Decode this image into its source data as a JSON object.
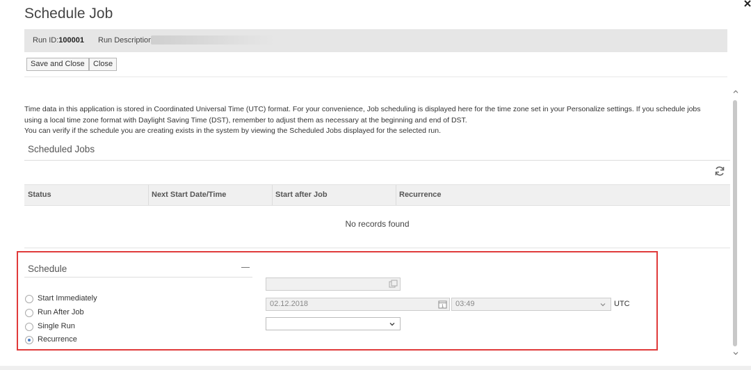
{
  "page": {
    "title": "Schedule Job"
  },
  "run": {
    "id_label": "Run ID:",
    "id_value": "100001",
    "description_label": "Run Description:"
  },
  "toolbar": {
    "save_close_label": "Save and Close",
    "close_label": "Close"
  },
  "info": {
    "line1": "Time data in this application is stored in Coordinated Universal Time (UTC) format. For your convenience, Job scheduling is displayed here for the time zone set in your Personalize settings. If you schedule jobs",
    "line2": "using a local time zone format with Daylight Saving Time (DST), remember to adjust them as necessary at the beginning and end of DST.",
    "line3": "You can verify if the schedule you are creating exists in the system by viewing the Scheduled Jobs displayed for the selected run."
  },
  "scheduled_jobs": {
    "title": "Scheduled Jobs",
    "columns": [
      "Status",
      "Next Start Date/Time",
      "Start after Job",
      "Recurrence"
    ],
    "empty_text": "No records found"
  },
  "schedule": {
    "title": "Schedule",
    "options": [
      {
        "label": "Start Immediately",
        "checked": false
      },
      {
        "label": "Run After Job",
        "checked": false
      },
      {
        "label": "Single Run",
        "checked": false
      },
      {
        "label": "Recurrence",
        "checked": true
      }
    ],
    "date_value": "02.12.2018",
    "time_value": "03:49",
    "timezone_label": "UTC",
    "recurrence_select_value": ""
  },
  "colors": {
    "highlight": "#e03a3a",
    "accent": "#4a7cc2"
  }
}
